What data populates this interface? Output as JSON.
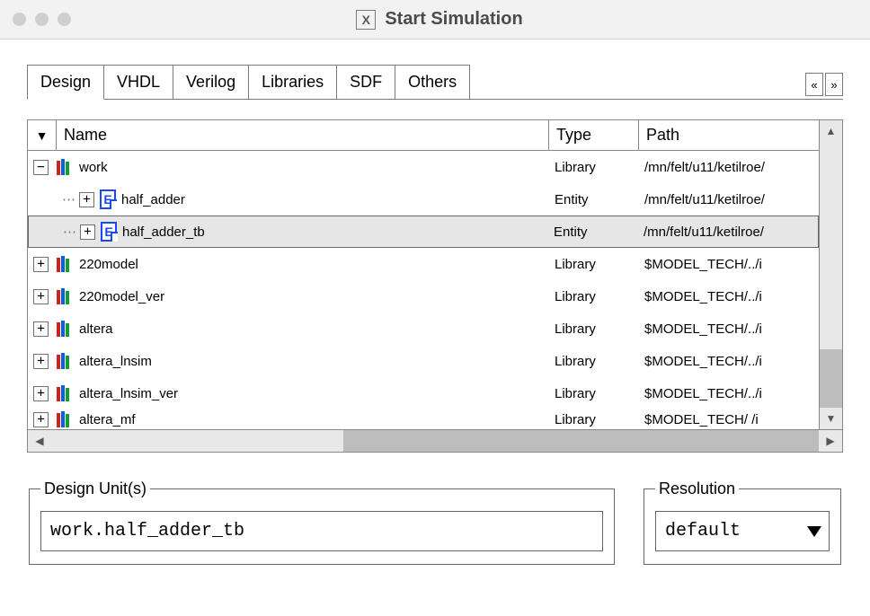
{
  "window": {
    "app_glyph": "X",
    "title": "Start Simulation"
  },
  "tabs": {
    "items": [
      "Design",
      "VHDL",
      "Verilog",
      "Libraries",
      "SDF",
      "Others"
    ],
    "active_index": 0,
    "scroll_left_glyph": "«",
    "scroll_right_glyph": "»"
  },
  "list": {
    "filter_glyph": "▼",
    "columns": [
      "Name",
      "Type",
      "Path"
    ],
    "rows": [
      {
        "indent": 0,
        "expander": "−",
        "icon": "library",
        "name": "work",
        "type": "Library",
        "path": "/mn/felt/u11/ketilroe/",
        "selected": false
      },
      {
        "indent": 1,
        "expander": "+",
        "icon": "entity",
        "name": "half_adder",
        "type": "Entity",
        "path": "/mn/felt/u11/ketilroe/",
        "selected": false
      },
      {
        "indent": 1,
        "expander": "+",
        "icon": "entity",
        "name": "half_adder_tb",
        "type": "Entity",
        "path": "/mn/felt/u11/ketilroe/",
        "selected": true
      },
      {
        "indent": 0,
        "expander": "+",
        "icon": "library",
        "name": "220model",
        "type": "Library",
        "path": "$MODEL_TECH/../i",
        "selected": false
      },
      {
        "indent": 0,
        "expander": "+",
        "icon": "library",
        "name": "220model_ver",
        "type": "Library",
        "path": "$MODEL_TECH/../i",
        "selected": false
      },
      {
        "indent": 0,
        "expander": "+",
        "icon": "library",
        "name": "altera",
        "type": "Library",
        "path": "$MODEL_TECH/../i",
        "selected": false
      },
      {
        "indent": 0,
        "expander": "+",
        "icon": "library",
        "name": "altera_lnsim",
        "type": "Library",
        "path": "$MODEL_TECH/../i",
        "selected": false
      },
      {
        "indent": 0,
        "expander": "+",
        "icon": "library",
        "name": "altera_lnsim_ver",
        "type": "Library",
        "path": "$MODEL_TECH/../i",
        "selected": false
      },
      {
        "indent": 0,
        "expander": "+",
        "icon": "library",
        "name": "altera_mf",
        "type": "Library",
        "path": "$MODEL_TECH/  /i",
        "selected": false
      }
    ]
  },
  "design_units": {
    "legend": "Design Unit(s)",
    "value": "work.half_adder_tb"
  },
  "resolution": {
    "legend": "Resolution",
    "value": "default"
  }
}
